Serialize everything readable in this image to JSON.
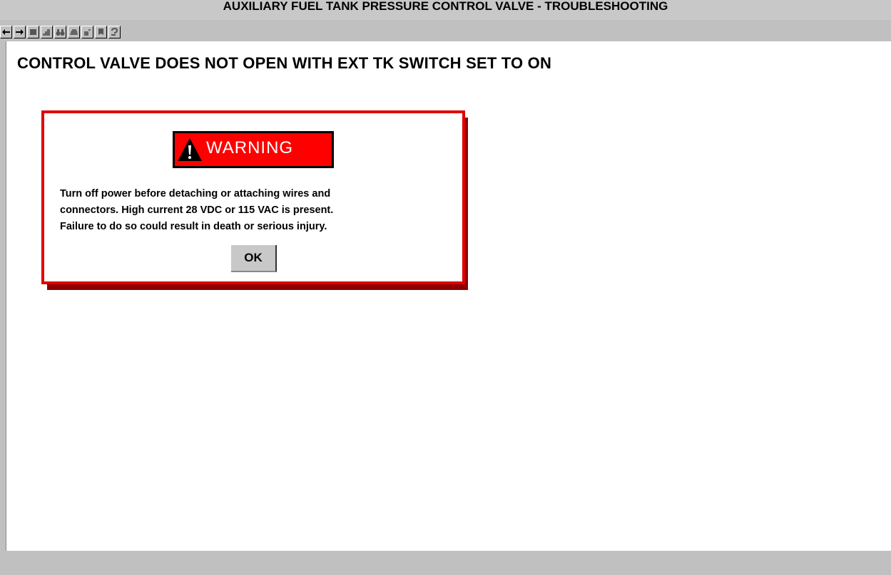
{
  "window": {
    "title": "AUXILIARY FUEL TANK PRESSURE CONTROL VALVE - TROUBLESHOOTING"
  },
  "toolbar": {
    "buttons": [
      {
        "name": "back-button",
        "icon": "arrow-left-icon"
      },
      {
        "name": "forward-button",
        "icon": "arrow-right-icon"
      },
      {
        "name": "stop-button",
        "icon": "square-icon"
      },
      {
        "name": "step-button",
        "icon": "staircase-icon"
      },
      {
        "name": "find-button",
        "icon": "binoculars-icon"
      },
      {
        "name": "print-button",
        "icon": "printer-icon"
      },
      {
        "name": "bookmark-button",
        "icon": "flag-icon"
      },
      {
        "name": "notes-button",
        "icon": "page-icon"
      },
      {
        "name": "help-button",
        "icon": "help-icon"
      }
    ]
  },
  "page": {
    "heading": "CONTROL VALVE DOES NOT OPEN WITH EXT TK SWITCH SET TO ON"
  },
  "dialog": {
    "badge": "WARNING",
    "message_lines": [
      "Turn off power before detaching or attaching wires and",
      "connectors.  High current 28 VDC or 115 VAC is present.",
      "Failure to do so could result in death or serious injury."
    ],
    "ok_label": "OK",
    "colors": {
      "border": "#e00000",
      "badge_bg": "#ff0000",
      "shadow": "#8c0000"
    }
  }
}
